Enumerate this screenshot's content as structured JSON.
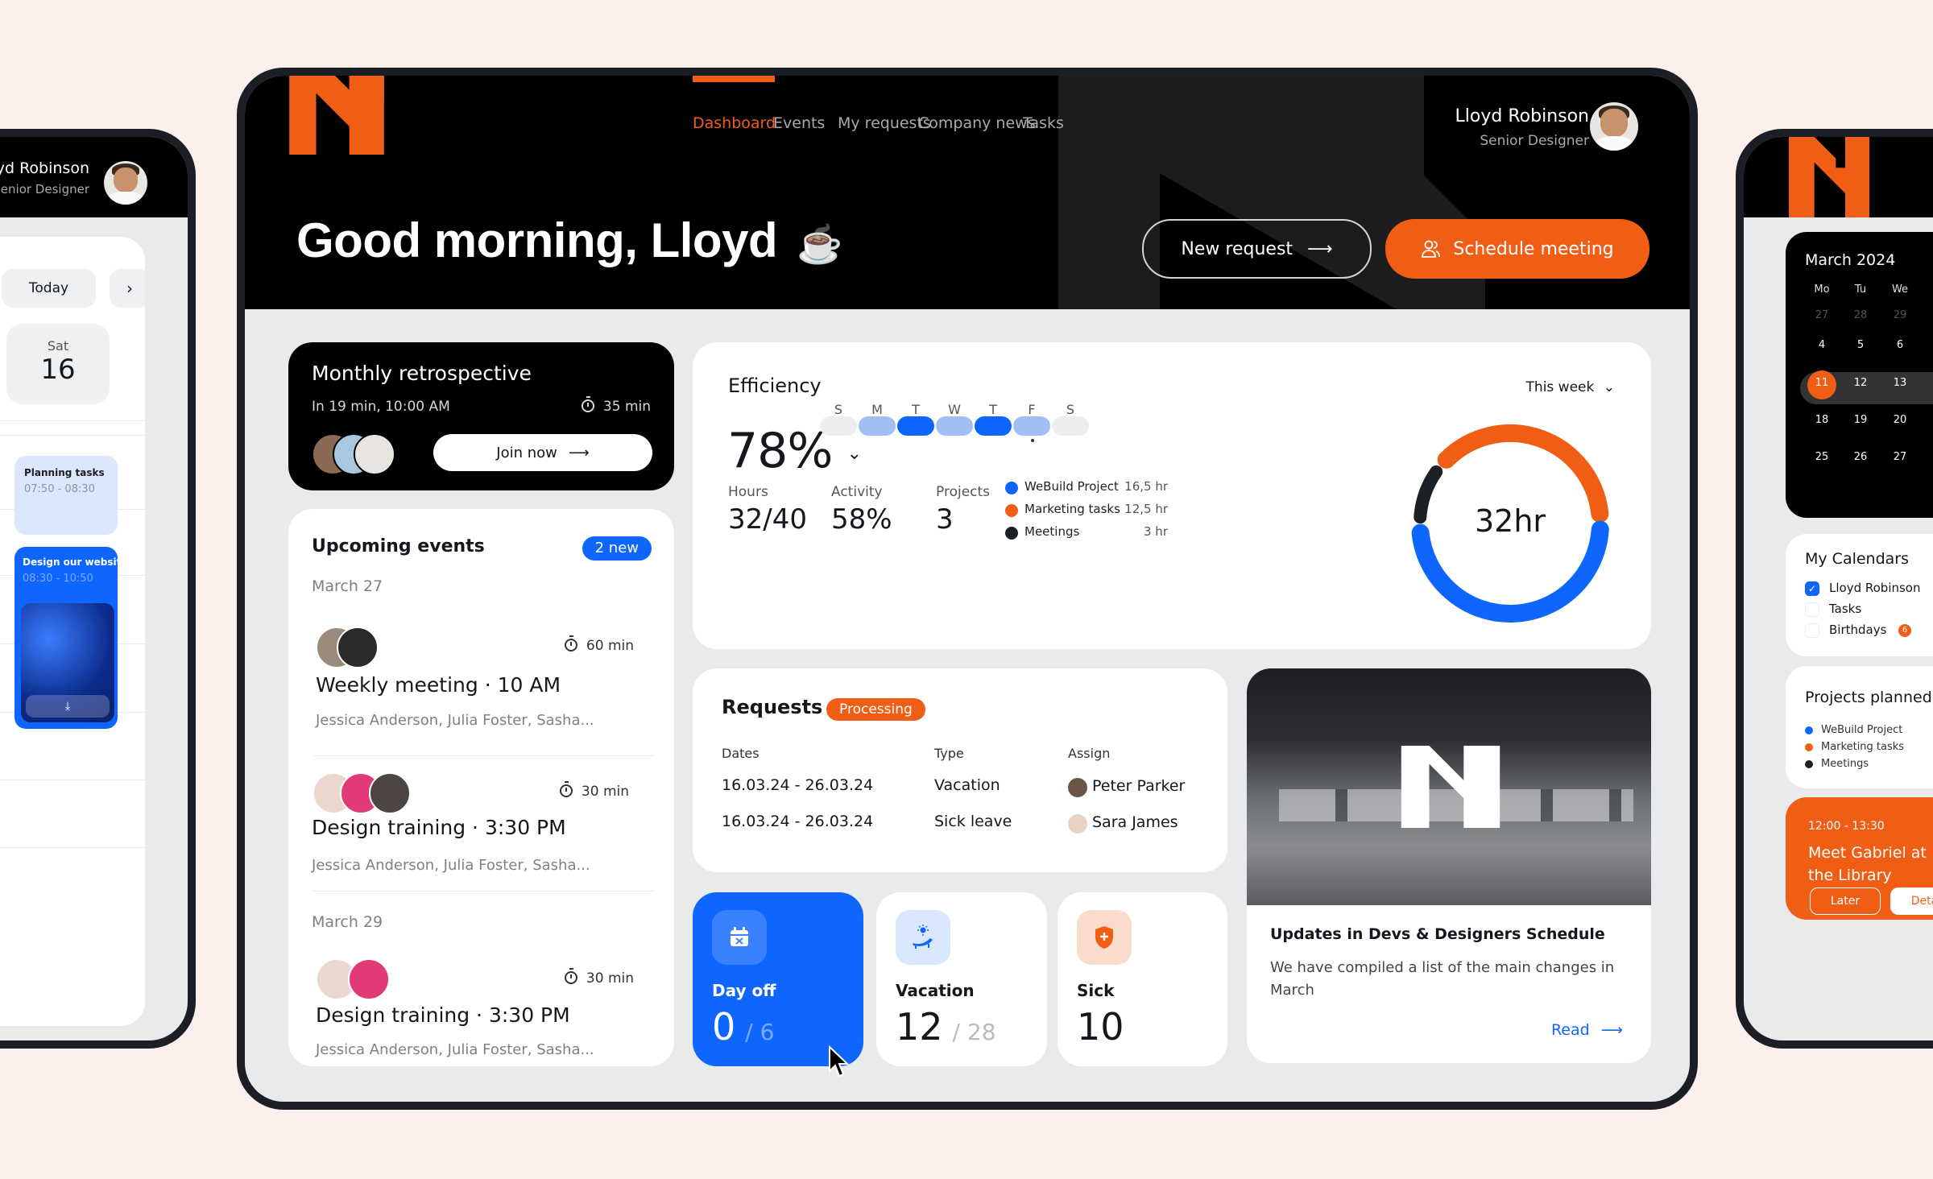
{
  "colors": {
    "accent_orange": "#f05e16",
    "accent_blue": "#0f66ff",
    "dark": "#14171c",
    "background": "#fcefec"
  },
  "main": {
    "nav": [
      {
        "label": "Dashboard",
        "active": true
      },
      {
        "label": "Events",
        "active": false
      },
      {
        "label": "My requests",
        "active": false
      },
      {
        "label": "Company news",
        "active": false
      },
      {
        "label": "Tasks",
        "active": false
      }
    ],
    "user": {
      "name": "Lloyd Robinson",
      "role": "Senior Designer",
      "avatar_icon": "user-avatar"
    },
    "greeting": "Good morning, Lloyd",
    "greeting_emoji": "☕",
    "new_request_label": "New request",
    "schedule_meeting_label": "Schedule meeting",
    "retro": {
      "title": "Monthly retrospective",
      "when": "In 19 min, 10:00 AM",
      "duration": "35 min",
      "join_label": "Join now"
    },
    "upcoming": {
      "title": "Upcoming events",
      "badge": "2 new",
      "groups": [
        {
          "date": "March 27",
          "events": [
            {
              "title": "Weekly meeting · 10 AM",
              "duration": "60 min",
              "attendees": "Jessica Anderson, Julia Foster, Sasha..."
            },
            {
              "title": "Design training · 3:30 PM",
              "duration": "30 min",
              "attendees": "Jessica Anderson, Julia Foster, Sasha..."
            }
          ]
        },
        {
          "date": "March 29",
          "events": [
            {
              "title": "Design training · 3:30 PM",
              "duration": "30 min",
              "attendees": "Jessica Anderson, Julia Foster, Sasha..."
            }
          ]
        }
      ]
    },
    "efficiency": {
      "title": "Efficiency",
      "value": "78%",
      "period": "This week",
      "days": [
        {
          "label": "S",
          "level": "none"
        },
        {
          "label": "M",
          "level": "light"
        },
        {
          "label": "T",
          "level": "full"
        },
        {
          "label": "W",
          "level": "light"
        },
        {
          "label": "T",
          "level": "full"
        },
        {
          "label": "F",
          "level": "light",
          "today": true
        },
        {
          "label": "S",
          "level": "none"
        }
      ],
      "stats": [
        {
          "label": "Hours",
          "value": "32/40"
        },
        {
          "label": "Activity",
          "value": "58%"
        },
        {
          "label": "Projects",
          "value": "3"
        }
      ],
      "legend": [
        {
          "name": "WeBuild Project",
          "value": "16,5 hr",
          "color": "#0f66ff"
        },
        {
          "name": "Marketing tasks",
          "value": "12,5 hr",
          "color": "#f05e16"
        },
        {
          "name": "Meetings",
          "value": "3 hr",
          "color": "#1b2124"
        }
      ],
      "donut_total": "32hr",
      "donut_hours": [
        16.5,
        12.5,
        3
      ]
    },
    "requests": {
      "title": "Requests",
      "status": "Processing",
      "columns": [
        "Dates",
        "Type",
        "Assign"
      ],
      "rows": [
        {
          "dates": "16.03.24 - 26.03.24",
          "type": "Vacation",
          "assign": "Peter Parker"
        },
        {
          "dates": "16.03.24 - 26.03.24",
          "type": "Sick leave",
          "assign": "Sara James"
        }
      ]
    },
    "balances": [
      {
        "label": "Day off",
        "used": "0",
        "total": "/ 6",
        "icon": "calendar-x-icon"
      },
      {
        "label": "Vacation",
        "used": "12",
        "total": "/ 28",
        "icon": "sunbed-icon"
      },
      {
        "label": "Sick",
        "used": "10",
        "total": "",
        "icon": "shield-plus-icon"
      }
    ],
    "news": {
      "title": "Updates in Devs & Designers Schedule",
      "body": "We have compiled a list of the main changes in March",
      "link": "Read"
    }
  },
  "left_device": {
    "user": {
      "name": "Lloyd Robinson",
      "role": "Senior Designer"
    },
    "today_label": "Today",
    "day": {
      "weekday": "Sat",
      "date": "16"
    },
    "events": [
      {
        "title": "Planning tasks",
        "time": "07:50 - 08:30"
      },
      {
        "title": "Design our website",
        "time": "08:30 - 10:50"
      }
    ]
  },
  "right_device": {
    "calendar": {
      "month": "March 2024",
      "weekdays": [
        "Mo",
        "Tu",
        "We"
      ],
      "weeks": [
        [
          "27",
          "28",
          "29"
        ],
        [
          "4",
          "5",
          "6"
        ],
        [
          "11",
          "12",
          "13"
        ],
        [
          "18",
          "19",
          "20"
        ],
        [
          "25",
          "26",
          "27"
        ]
      ],
      "selected": "11"
    },
    "my_calendars": {
      "title": "My Calendars",
      "items": [
        {
          "label": "Lloyd Robinson",
          "checked": true
        },
        {
          "label": "Tasks",
          "checked": false
        },
        {
          "label": "Birthdays",
          "checked": false,
          "badge": "6"
        }
      ]
    },
    "projects": {
      "title": "Projects planned",
      "items": [
        {
          "label": "WeBuild Project",
          "color": "#0f66ff"
        },
        {
          "label": "Marketing tasks",
          "color": "#f05e16"
        },
        {
          "label": "Meetings",
          "color": "#1b2124"
        }
      ]
    },
    "meeting": {
      "time": "12:00 - 13:30",
      "title": "Meet Gabriel at the Library",
      "later": "Later",
      "details": "Details"
    }
  }
}
